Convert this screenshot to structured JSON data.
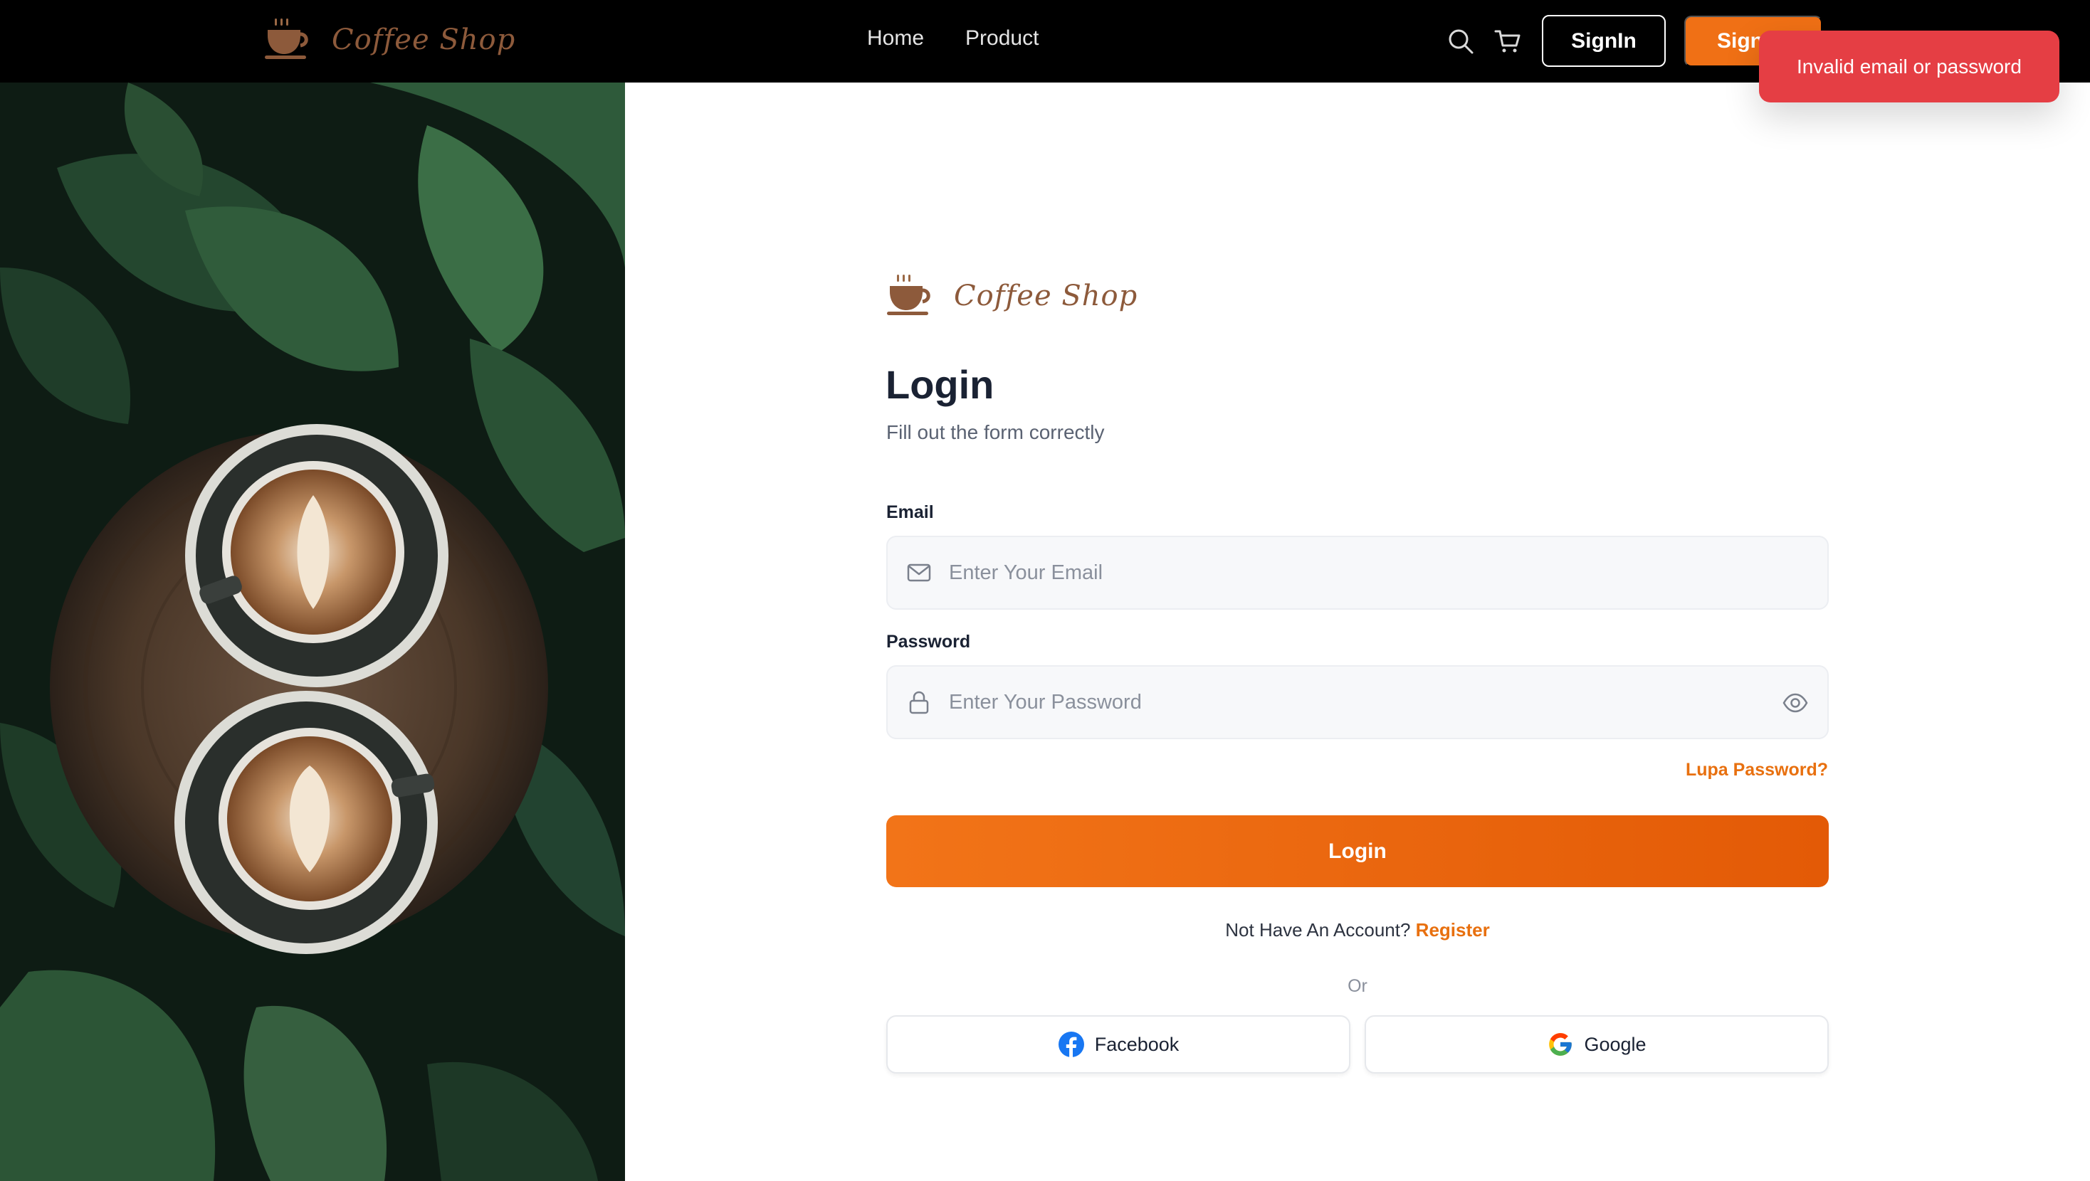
{
  "navbar": {
    "brand_name": "Coffee Shop",
    "links": [
      "Home",
      "Product"
    ],
    "icons": {
      "search": "search-icon",
      "cart": "cart-icon"
    },
    "signin_label": "SignIn",
    "signup_label": "Sign"
  },
  "toast": {
    "message": "Invalid email or password",
    "color": "#e53e44"
  },
  "form": {
    "brand_name": "Coffee Shop",
    "title": "Login",
    "subtitle": "Fill out the form correctly",
    "email": {
      "label": "Email",
      "placeholder": "Enter Your Email",
      "value": ""
    },
    "password": {
      "label": "Password",
      "placeholder": "Enter Your Password",
      "value": ""
    },
    "forgot_password": "Lupa Password?",
    "login_button": "Login",
    "register_prompt": "Not Have An Account?",
    "register_link": "Register",
    "or_text": "Or",
    "facebook_button": "Facebook",
    "google_button": "Google"
  },
  "colors": {
    "accent": "#f07015",
    "brand_text": "#8d5a3b",
    "navbar_bg": "#000000",
    "error": "#e53e44"
  }
}
